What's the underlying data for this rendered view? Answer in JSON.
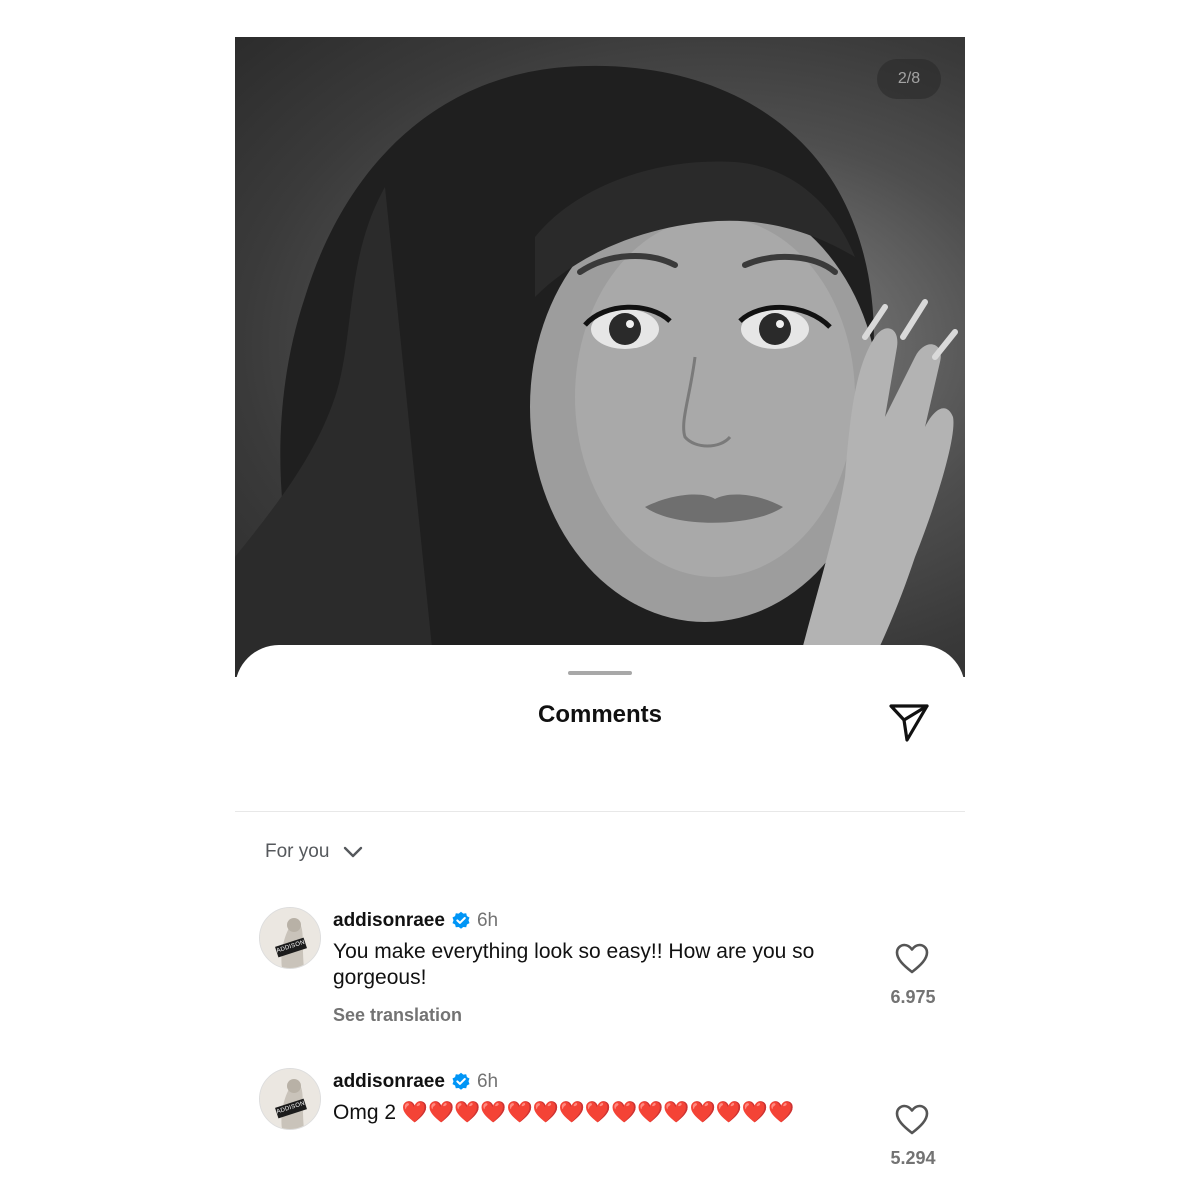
{
  "photo": {
    "counter": "2/8",
    "alt_subject": "portrait"
  },
  "sheet": {
    "title": "Comments",
    "filter_label": "For you"
  },
  "icons": {
    "share": "paper-plane-icon",
    "filter_chevron": "chevron-down-icon",
    "verified": "verified-badge-icon",
    "like": "heart-outline-icon"
  },
  "colors": {
    "verified_blue": "#0095f6",
    "heart_red": "#e0223a",
    "secondary_text": "#737373"
  },
  "comments": [
    {
      "username": "addisonraee",
      "time": "6h",
      "text": "You make everything look so easy!! How are you so gorgeous!",
      "see_translation": "See translation",
      "likes": "6.975"
    },
    {
      "username": "addisonraee",
      "time": "6h",
      "text_prefix": "Omg 2",
      "hearts": "❤️❤️❤️❤️❤️❤️❤️❤️❤️❤️❤️❤️❤️❤️❤️",
      "likes": "5.294"
    }
  ]
}
